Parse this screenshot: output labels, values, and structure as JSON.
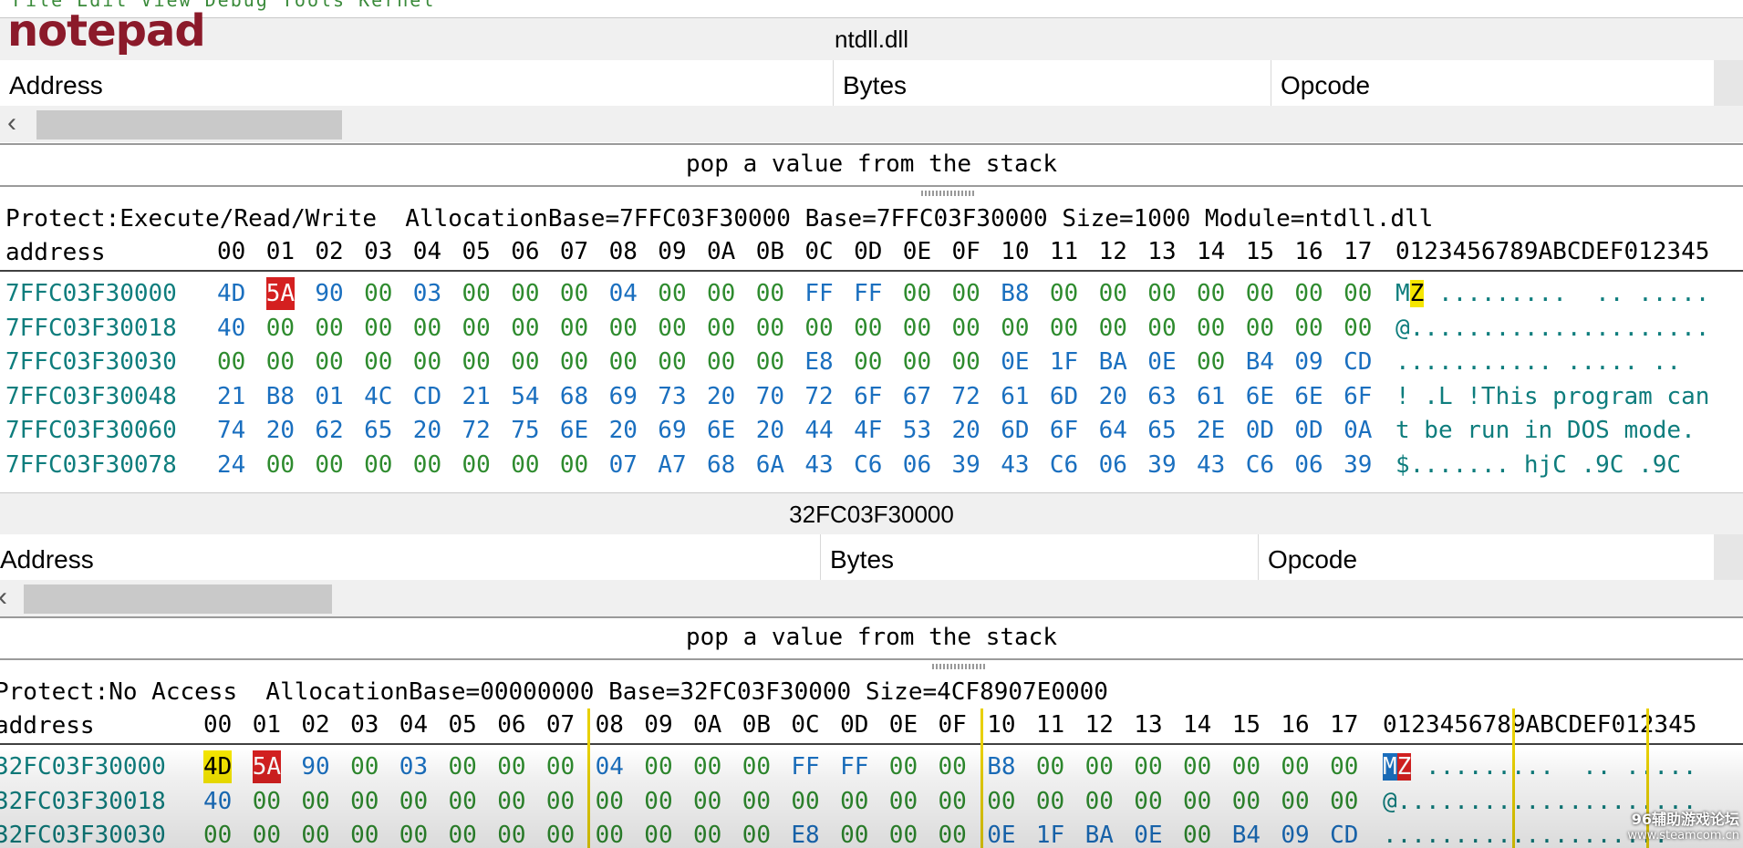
{
  "watermark_app": "notepad",
  "site_watermark": {
    "line1": "96辅助游戏论坛",
    "line2": "www.steamcom.cn"
  },
  "colors": {
    "title_red": "#8b1a2a",
    "addr_teal": "#0e7d7d",
    "byte_green": "#2e8b2e",
    "byte_blue": "#1a6fbf",
    "highlight_red": "#d42020",
    "highlight_yellow": "#f5e600"
  },
  "views": [
    {
      "title": "ntdll.dll",
      "columns": [
        "Address",
        "Bytes",
        "Opcode"
      ],
      "description": "pop a value from the stack",
      "hex": {
        "info": "Protect:Execute/Read/Write  AllocationBase=7FFC03F30000 Base=7FFC03F30000 Size=1000 Module=ntdll.dll",
        "address_label": "address",
        "offsets": [
          "00",
          "01",
          "02",
          "03",
          "04",
          "05",
          "06",
          "07",
          "08",
          "09",
          "0A",
          "0B",
          "0C",
          "0D",
          "0E",
          "0F",
          "10",
          "11",
          "12",
          "13",
          "14",
          "15",
          "16",
          "17"
        ],
        "ascii_header": "0123456789ABCDEF012345",
        "rows": [
          {
            "address": "7FFC03F30000",
            "bytes": [
              "4D",
              "5A",
              "90",
              "00",
              "03",
              "00",
              "00",
              "00",
              "04",
              "00",
              "00",
              "00",
              "FF",
              "FF",
              "00",
              "00",
              "B8",
              "00",
              "00",
              "00",
              "00",
              "00",
              "00",
              "00"
            ],
            "ascii": "MZ .........  .. ....."
          },
          {
            "address": "7FFC03F30018",
            "bytes": [
              "40",
              "00",
              "00",
              "00",
              "00",
              "00",
              "00",
              "00",
              "00",
              "00",
              "00",
              "00",
              "00",
              "00",
              "00",
              "00",
              "00",
              "00",
              "00",
              "00",
              "00",
              "00",
              "00",
              "00"
            ],
            "ascii": "@....................."
          },
          {
            "address": "7FFC03F30030",
            "bytes": [
              "00",
              "00",
              "00",
              "00",
              "00",
              "00",
              "00",
              "00",
              "00",
              "00",
              "00",
              "00",
              "E8",
              "00",
              "00",
              "00",
              "0E",
              "1F",
              "BA",
              "0E",
              "00",
              "B4",
              "09",
              "CD"
            ],
            "ascii": "........... ..... .."
          },
          {
            "address": "7FFC03F30048",
            "bytes": [
              "21",
              "B8",
              "01",
              "4C",
              "CD",
              "21",
              "54",
              "68",
              "69",
              "73",
              "20",
              "70",
              "72",
              "6F",
              "67",
              "72",
              "61",
              "6D",
              "20",
              "63",
              "61",
              "6E",
              "6E",
              "6F"
            ],
            "ascii": "! .L !This program can"
          },
          {
            "address": "7FFC03F30060",
            "bytes": [
              "74",
              "20",
              "62",
              "65",
              "20",
              "72",
              "75",
              "6E",
              "20",
              "69",
              "6E",
              "20",
              "44",
              "4F",
              "53",
              "20",
              "6D",
              "6F",
              "64",
              "65",
              "2E",
              "0D",
              "0D",
              "0A"
            ],
            "ascii": "t be run in DOS mode."
          },
          {
            "address": "7FFC03F30078",
            "bytes": [
              "24",
              "00",
              "00",
              "00",
              "00",
              "00",
              "00",
              "00",
              "07",
              "A7",
              "68",
              "6A",
              "43",
              "C6",
              "06",
              "39",
              "43",
              "C6",
              "06",
              "39",
              "43",
              "C6",
              "06",
              "39"
            ],
            "ascii": "$....... hjC .9C .9C"
          }
        ]
      }
    },
    {
      "title": "32FC03F30000",
      "columns": [
        "Address",
        "Bytes",
        "Opcode"
      ],
      "description": "pop a value from the stack",
      "hex": {
        "info": "Protect:No Access  AllocationBase=00000000 Base=32FC03F30000 Size=4CF8907E0000",
        "address_label": "address",
        "offsets": [
          "00",
          "01",
          "02",
          "03",
          "04",
          "05",
          "06",
          "07",
          "08",
          "09",
          "0A",
          "0B",
          "0C",
          "0D",
          "0E",
          "0F",
          "10",
          "11",
          "12",
          "13",
          "14",
          "15",
          "16",
          "17"
        ],
        "ascii_header": "0123456789ABCDEF012345",
        "rows": [
          {
            "address": "32FC03F30000",
            "bytes": [
              "4D",
              "5A",
              "90",
              "00",
              "03",
              "00",
              "00",
              "00",
              "04",
              "00",
              "00",
              "00",
              "FF",
              "FF",
              "00",
              "00",
              "B8",
              "00",
              "00",
              "00",
              "00",
              "00",
              "00",
              "00"
            ],
            "ascii": "MZ .........  .. ....."
          },
          {
            "address": "32FC03F30018",
            "bytes": [
              "40",
              "00",
              "00",
              "00",
              "00",
              "00",
              "00",
              "00",
              "00",
              "00",
              "00",
              "00",
              "00",
              "00",
              "00",
              "00",
              "00",
              "00",
              "00",
              "00",
              "00",
              "00",
              "00",
              "00"
            ],
            "ascii": "@....................."
          },
          {
            "address": "32FC03F30030",
            "bytes": [
              "00",
              "00",
              "00",
              "00",
              "00",
              "00",
              "00",
              "00",
              "00",
              "00",
              "00",
              "00",
              "E8",
              "00",
              "00",
              "00",
              "0E",
              "1F",
              "BA",
              "0E",
              "00",
              "B4",
              "09",
              "CD"
            ],
            "ascii": "...................."
          }
        ]
      }
    }
  ]
}
